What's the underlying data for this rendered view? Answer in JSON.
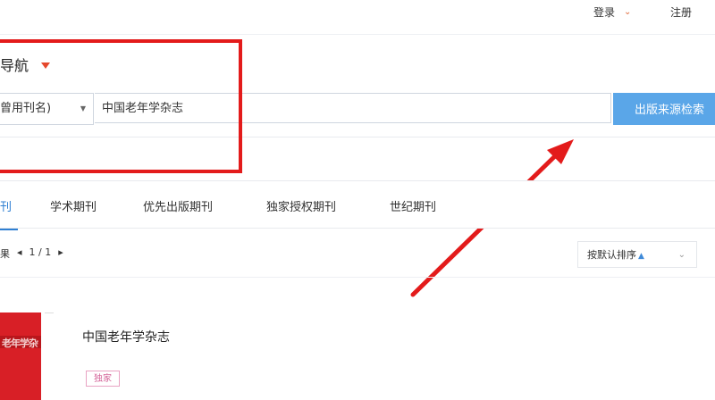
{
  "header": {
    "login_label": "登录",
    "register_label": "注册"
  },
  "nav": {
    "title": "导航"
  },
  "search": {
    "select_value": "曾用刊名)",
    "input_value": "中国老年学杂志",
    "button_label": "出版来源检索"
  },
  "tabs": [
    {
      "label": "刊"
    },
    {
      "label": "学术期刊"
    },
    {
      "label": "优先出版期刊"
    },
    {
      "label": "独家授权期刊"
    },
    {
      "label": "世纪期刊"
    }
  ],
  "pager": {
    "prefix": "果",
    "page_text": "1 / 1"
  },
  "sort": {
    "label": "按默认排序"
  },
  "result": {
    "cover_text": "老年学杂",
    "title": "中国老年学杂志",
    "badge": "独家"
  },
  "colors": {
    "accent_blue": "#5aa6e8",
    "annotation_red": "#e31b1b"
  },
  "icons": {
    "dropdown": "chevron-down-icon",
    "sort": "sort-icon"
  }
}
